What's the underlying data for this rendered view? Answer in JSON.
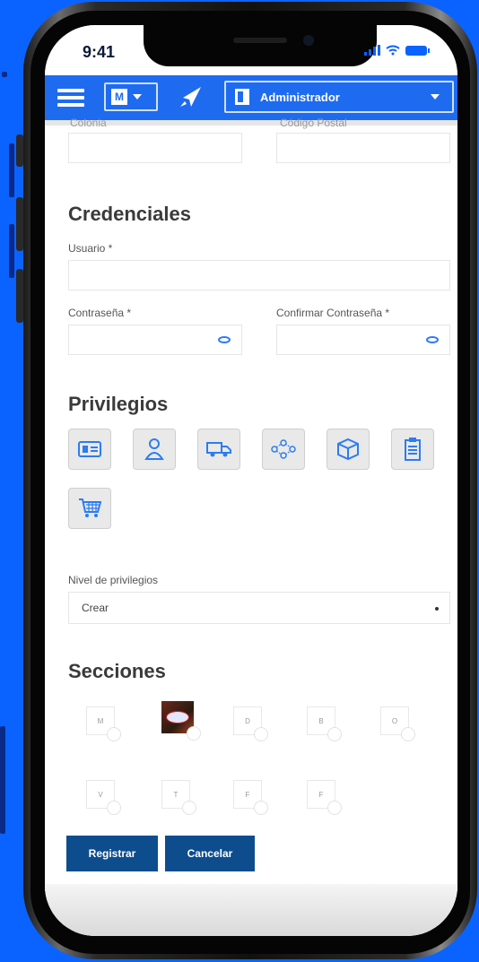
{
  "status_bar": {
    "time": "9:41"
  },
  "toolbar": {
    "menu_icon": "hamburger-icon",
    "module_select_value": "M",
    "rocket_icon": "rocket-icon",
    "role_select_value": "Administrador",
    "accent_color": "#1e6bf0"
  },
  "form": {
    "address": {
      "colonia_label": "Colonia",
      "codigo_postal_label": "Código Postal",
      "colonia_value": "",
      "codigo_postal_value": ""
    },
    "credentials": {
      "title": "Credenciales",
      "usuario_label": "Usuario *",
      "usuario_value": "",
      "password_label": "Contraseña *",
      "confirm_label": "Confirmar Contraseña *"
    },
    "privileges": {
      "title": "Privilegios",
      "icons": [
        "id-card-icon",
        "user-icon",
        "truck-icon",
        "flow-icon",
        "box-icon",
        "clipboard-icon",
        "cart-icon"
      ],
      "level_label": "Nivel de privilegios",
      "level_value": "Crear"
    },
    "sections": {
      "title": "Secciones",
      "row1": [
        "M",
        "",
        "D",
        "B",
        "O"
      ],
      "row2": [
        "V",
        "T",
        "F",
        "F"
      ]
    },
    "buttons": {
      "register": "Registrar",
      "cancel": "Cancelar"
    }
  }
}
